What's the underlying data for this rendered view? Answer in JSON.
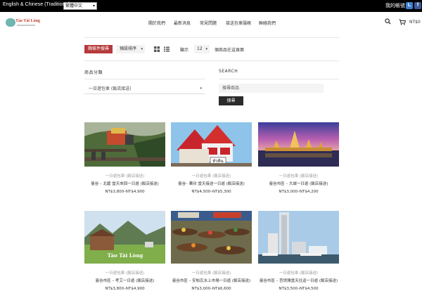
{
  "topbar": {
    "language_label": "English & Chinese (Traditional)",
    "language_select": "繁體中文",
    "account_link": "我的帳號",
    "social": [
      {
        "icon": "line-icon",
        "glyph": "L",
        "color": "#3b7fd1"
      },
      {
        "icon": "facebook-icon",
        "glyph": "f",
        "color": "#3b5998"
      }
    ]
  },
  "header": {
    "logo_text": "Tào Tài Lòng",
    "nav": [
      "關於我們",
      "最新消息",
      "常見問題",
      "接送包車服務",
      "聯絡我們"
    ],
    "cart_total": "NT$0"
  },
  "toolbar": {
    "filter_button": "篩條件搜尋",
    "sort_select": "預設排序",
    "show_label": "顯示",
    "per_page": "12",
    "per_page_note": "個商品在這頁面"
  },
  "filters": {
    "category_title": "商品分類",
    "category_select": "一日遊包車 (飯店接送)",
    "search_title": "SEARCH",
    "search_placeholder": "搜尋商品",
    "search_button": "搜尋"
  },
  "products": [
    {
      "category": "一日遊包車 (飯店接送)",
      "title": "曼谷 – 北碧 當天來回一日遊 (飯店接送)",
      "price": "NT$3,800–NT$4,900",
      "image": "train-on-bridge"
    },
    {
      "category": "一日遊包車 (飯店接送)",
      "title": "曼谷– 華欣 當天接送一日遊 (飯店接送)",
      "price": "NT$4,500–NT$5,300",
      "image": "hua-hin-station"
    },
    {
      "category": "一日遊包車 (飯店接送)",
      "title": "曼谷市區 – 大城一日遊 (飯店接送)",
      "price": "NT$3,000–NT$4,200",
      "image": "ayutthaya-temple-dusk"
    },
    {
      "category": "一日遊包車 (飯店接送)",
      "title": "曼谷市區 – 考艾一日遊 (飯店接送)",
      "price": "NT$3,800–NT$4,900",
      "image": "khao-yai-farm"
    },
    {
      "category": "一日遊包車 (飯店接送)",
      "title": "曼谷市區 – 安帕瓦水上市場一日遊 (飯店接送)",
      "price": "NT$3,000–NT$6,600",
      "image": "floating-market"
    },
    {
      "category": "一日遊包車 (飯店接送)",
      "title": "曼谷市區 – 芭堤雅當天往返一日遊 (飯店接送)",
      "price": "NT$3,500–NT$4,500",
      "image": "pattaya-towers"
    }
  ],
  "watermark": "Tào Tài Lòng",
  "colors": {
    "accent": "#b53a3a",
    "topbar": "#000000",
    "button_dark": "#2b2b2b"
  }
}
